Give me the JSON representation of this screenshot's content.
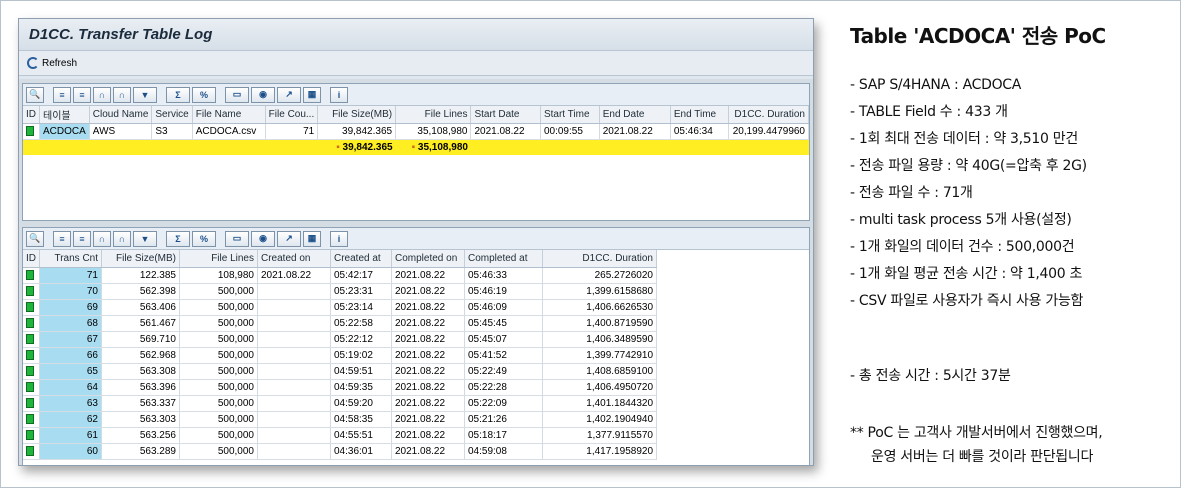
{
  "sap": {
    "title": "D1CC. Transfer Table Log",
    "refresh_label": "Refresh"
  },
  "top_grid": {
    "columns": [
      "ID",
      "테이블",
      "Cloud Name",
      "Service",
      "File Name",
      "File Cou...",
      "File Size(MB)",
      "File Lines",
      "Start Date",
      "Start Time",
      "End Date",
      "End Time",
      "D1CC. Duration"
    ],
    "row": {
      "table": "ACDOCA",
      "cloud": "AWS",
      "service": "S3",
      "file_name": "ACDOCA.csv",
      "file_count": "71",
      "file_size": "39,842.365",
      "file_lines": "35,108,980",
      "start_date": "2021.08.22",
      "start_time": "00:09:55",
      "end_date": "2021.08.22",
      "end_time": "05:46:34",
      "duration": "20,199.4479960"
    },
    "totals": {
      "file_size": "39,842.365",
      "file_lines": "35,108,980"
    }
  },
  "bottom_grid": {
    "columns": [
      "ID",
      "Trans Cnt",
      "File Size(MB)",
      "File Lines",
      "Created on",
      "Created at",
      "Completed on",
      "Completed at",
      "D1CC. Duration"
    ],
    "rows": [
      {
        "cnt": "71",
        "size": "122.385",
        "lines": "108,980",
        "created_on": "2021.08.22",
        "created_at": "05:42:17",
        "completed_on": "2021.08.22",
        "completed_at": "05:46:33",
        "duration": "265.2726020"
      },
      {
        "cnt": "70",
        "size": "562.398",
        "lines": "500,000",
        "created_on": "",
        "created_at": "05:23:31",
        "completed_on": "2021.08.22",
        "completed_at": "05:46:19",
        "duration": "1,399.6158680"
      },
      {
        "cnt": "69",
        "size": "563.406",
        "lines": "500,000",
        "created_on": "",
        "created_at": "05:23:14",
        "completed_on": "2021.08.22",
        "completed_at": "05:46:09",
        "duration": "1,406.6626530"
      },
      {
        "cnt": "68",
        "size": "561.467",
        "lines": "500,000",
        "created_on": "",
        "created_at": "05:22:58",
        "completed_on": "2021.08.22",
        "completed_at": "05:45:45",
        "duration": "1,400.8719590"
      },
      {
        "cnt": "67",
        "size": "569.710",
        "lines": "500,000",
        "created_on": "",
        "created_at": "05:22:12",
        "completed_on": "2021.08.22",
        "completed_at": "05:45:07",
        "duration": "1,406.3489590"
      },
      {
        "cnt": "66",
        "size": "562.968",
        "lines": "500,000",
        "created_on": "",
        "created_at": "05:19:02",
        "completed_on": "2021.08.22",
        "completed_at": "05:41:52",
        "duration": "1,399.7742910"
      },
      {
        "cnt": "65",
        "size": "563.308",
        "lines": "500,000",
        "created_on": "",
        "created_at": "04:59:51",
        "completed_on": "2021.08.22",
        "completed_at": "05:22:49",
        "duration": "1,408.6859100"
      },
      {
        "cnt": "64",
        "size": "563.396",
        "lines": "500,000",
        "created_on": "",
        "created_at": "04:59:35",
        "completed_on": "2021.08.22",
        "completed_at": "05:22:28",
        "duration": "1,406.4950720"
      },
      {
        "cnt": "63",
        "size": "563.337",
        "lines": "500,000",
        "created_on": "",
        "created_at": "04:59:20",
        "completed_on": "2021.08.22",
        "completed_at": "05:22:09",
        "duration": "1,401.1844320"
      },
      {
        "cnt": "62",
        "size": "563.303",
        "lines": "500,000",
        "created_on": "",
        "created_at": "04:58:35",
        "completed_on": "2021.08.22",
        "completed_at": "05:21:26",
        "duration": "1,402.1904940"
      },
      {
        "cnt": "61",
        "size": "563.256",
        "lines": "500,000",
        "created_on": "",
        "created_at": "04:55:51",
        "completed_on": "2021.08.22",
        "completed_at": "05:18:17",
        "duration": "1,377.9115570"
      },
      {
        "cnt": "60",
        "size": "563.289",
        "lines": "500,000",
        "created_on": "",
        "created_at": "04:36:01",
        "completed_on": "2021.08.22",
        "completed_at": "04:59:08",
        "duration": "1,417.1958920"
      }
    ]
  },
  "notes": {
    "title": "Table 'ACDOCA' 전송 PoC",
    "items": [
      "-  SAP S/4HANA : ACDOCA",
      "- TABLE Field 수 : 433 개",
      "- 1회 최대 전송 데이터 : 약 3,510 만건",
      "- 전송 파일 용량 : 약 40G(=압축 후 2G)",
      "- 전송 파일 수 : 71개",
      "- multi task process 5개 사용(설정)",
      "- 1개 화일의 데이터 건수 : 500,000건",
      "- 1개 화일 평균 전송 시간 : 약 1,400 초",
      "- CSV 파일로 사용자가 즉시 사용 가능함"
    ],
    "total": "- 총 전송 시간 : 5시간 37분",
    "footnote_line1": "** PoC 는 고객사 개발서버에서 진행했으며,",
    "footnote_line2": "운영 서버는 더 빠를 것이라 판단됩니다"
  }
}
